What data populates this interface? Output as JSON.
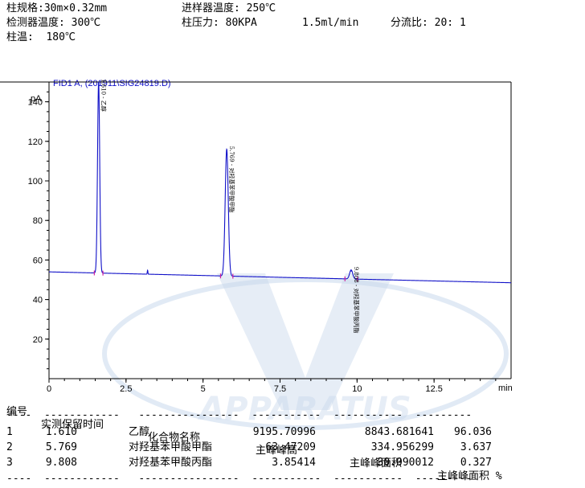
{
  "conditions": {
    "column_spec": "柱规格:30m×0.32mm",
    "detector_temp": "检测器温度: 300℃",
    "column_temp": "柱温:  180℃",
    "inlet_temp": "进样器温度: 250℃",
    "column_pressure": "柱压力: 80KPA",
    "flow": "1.5ml/min",
    "split_ratio": "分流比: 20: 1"
  },
  "watermark_text": "APPARATUS",
  "colors": {
    "trace": "#1010c8",
    "header_text": "#1010c8",
    "baseline_mark": "#d020a0",
    "axis": "#000000",
    "watermark": "#c8d8ec"
  },
  "chart_data": {
    "type": "line",
    "title": "FID1 A, (201911\\SIG24819.D)",
    "ylabel": "pA",
    "xlabel": "min",
    "xlim": [
      0,
      15
    ],
    "ylim": [
      0,
      150
    ],
    "x_ticks": [
      0,
      2.5,
      5,
      7.5,
      10,
      12.5
    ],
    "x_tick_labels": [
      "0",
      "2.5",
      "5",
      "7.5",
      "10",
      "12.5"
    ],
    "y_ticks": [
      20,
      40,
      60,
      80,
      100,
      120,
      140
    ],
    "y_tick_labels": [
      "20",
      "40",
      "60",
      "80",
      "100",
      "120",
      "140"
    ],
    "grid": false,
    "baseline": {
      "start": 54.0,
      "end": 48.5
    },
    "small_spike": {
      "x": 3.2,
      "height": 2.0
    },
    "peaks": [
      {
        "rt": 1.61,
        "apex": 150,
        "label": "1.610 - 乙醇"
      },
      {
        "rt": 5.769,
        "apex": 116,
        "label": "5.769 - 对羟基苯甲酸甲酯"
      },
      {
        "rt": 9.808,
        "apex": 55,
        "label": "9.808 - 对羟基苯甲酸丙酯"
      }
    ]
  },
  "table": {
    "headers": [
      "编号",
      "实测保留时间",
      "化合物名称",
      "主峰峰高",
      "主峰峰面积",
      "主峰峰面积 %"
    ],
    "rows": [
      {
        "no": "1",
        "rt": "1.610",
        "name": "乙醇",
        "height": "9195.70996",
        "area": "8843.681641",
        "pct": "96.036"
      },
      {
        "no": "2",
        "rt": "5.769",
        "name": "对羟基苯甲酸甲酯",
        "height": "63.47209",
        "area": "334.956299",
        "pct": "3.637"
      },
      {
        "no": "3",
        "rt": "9.808",
        "name": "对羟基苯甲酸丙酯",
        "height": "3.85414",
        "area": "30.090012",
        "pct": "0.327"
      }
    ]
  }
}
